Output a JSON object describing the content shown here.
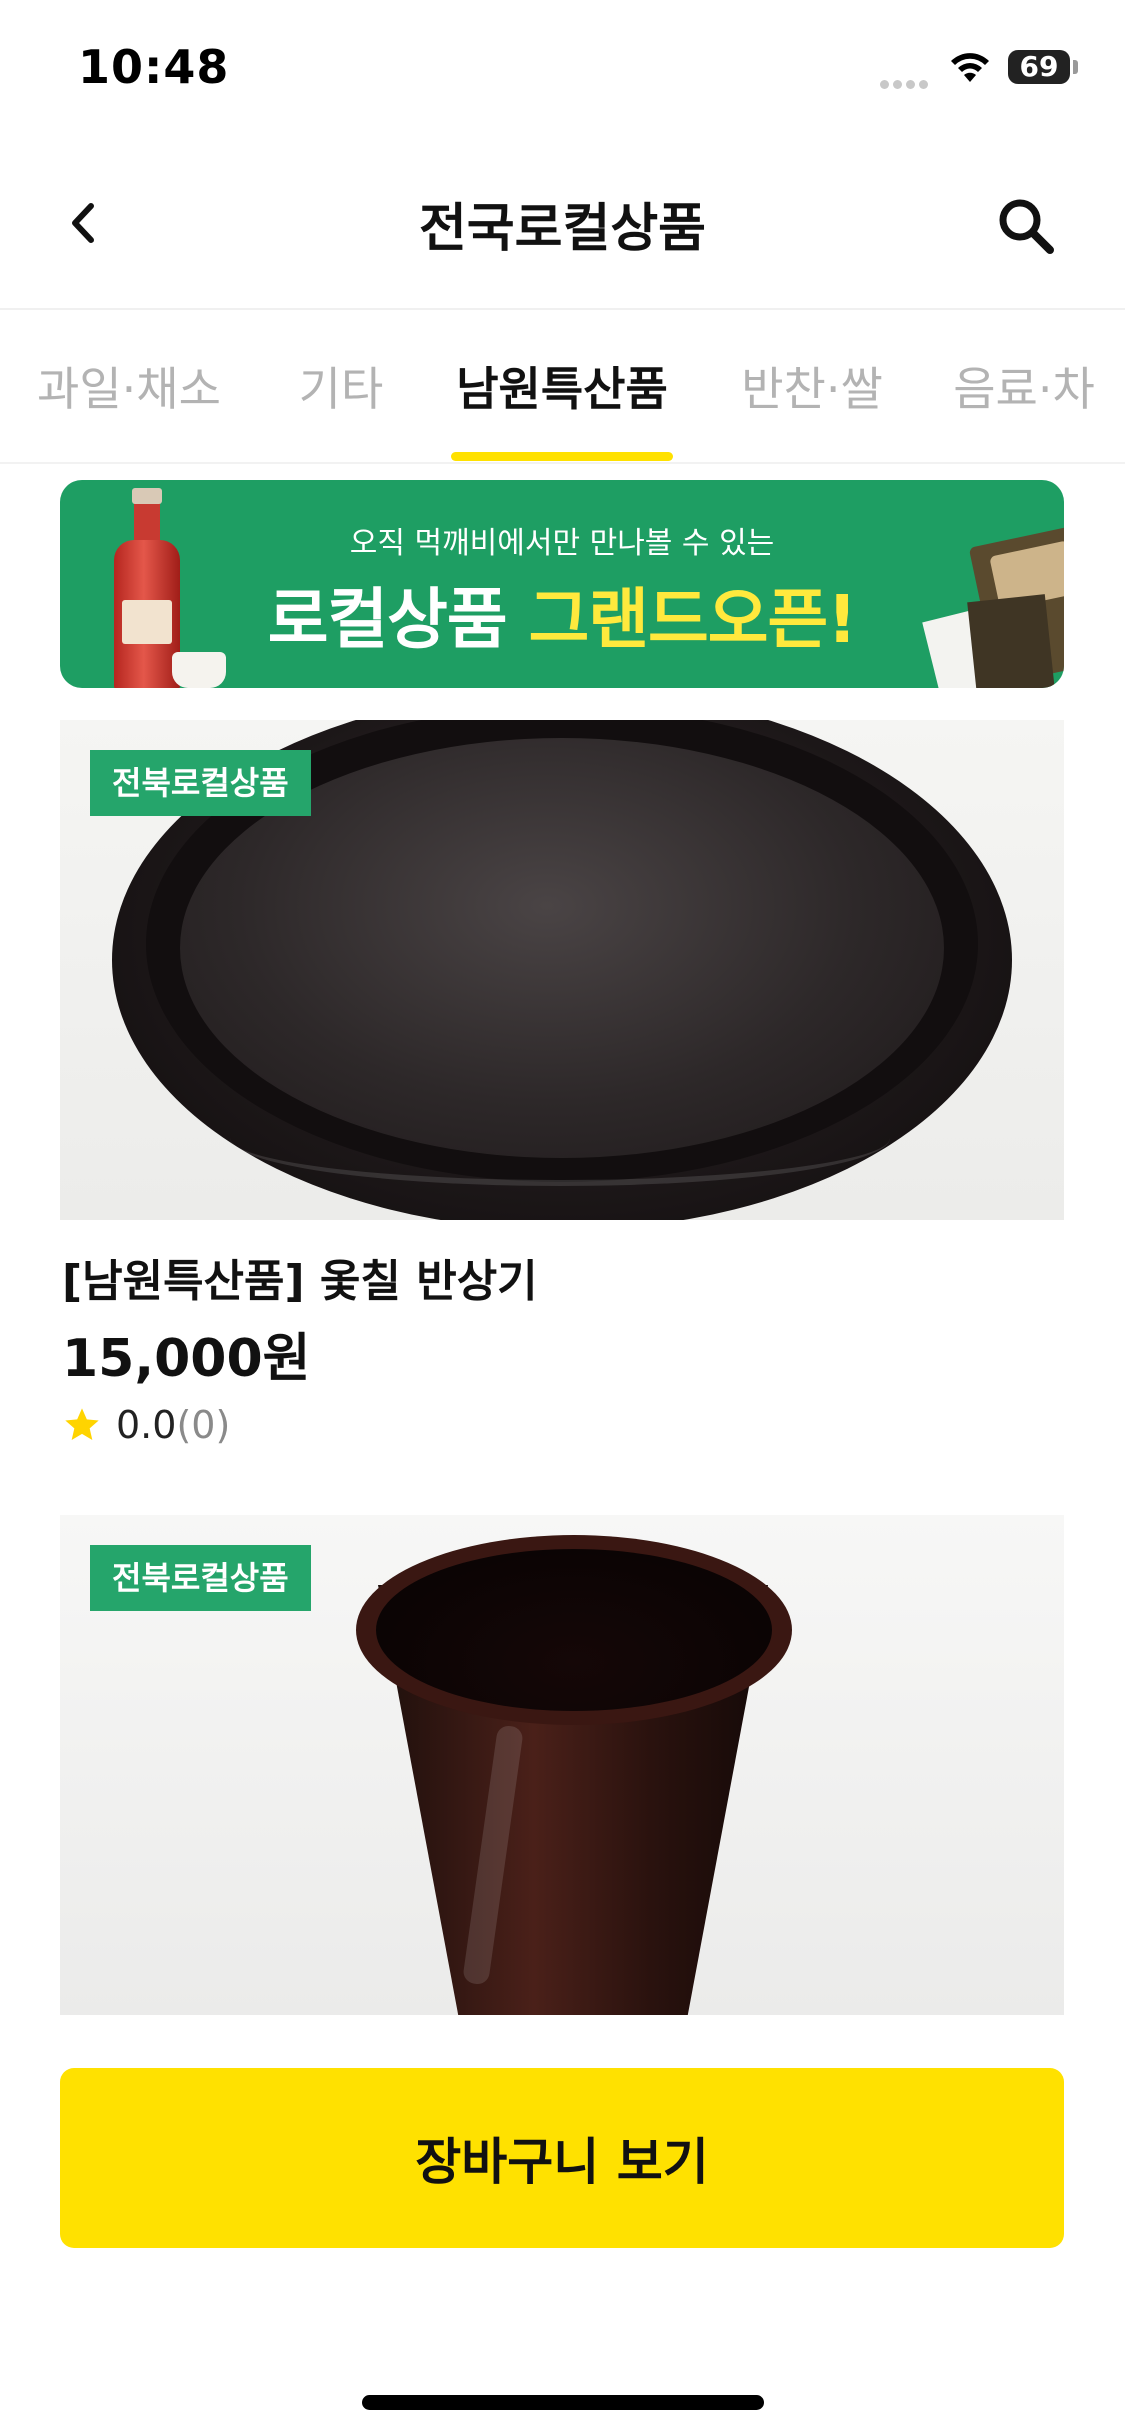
{
  "status_bar": {
    "time": "10:48",
    "battery": "69"
  },
  "header": {
    "title": "전국로컬상품"
  },
  "tabs": [
    {
      "label": "과일·채소",
      "active": false
    },
    {
      "label": "기타",
      "active": false
    },
    {
      "label": "남원특산품",
      "active": true
    },
    {
      "label": "반찬·쌀",
      "active": false
    },
    {
      "label": "음료·차",
      "active": false
    }
  ],
  "banner": {
    "subtitle": "오직 먹깨비에서만 만나볼 수 있는",
    "title_main": "로컬상품",
    "title_highlight": "그랜드오픈!"
  },
  "products": [
    {
      "badge": "전북로컬상품",
      "name": "[남원특산품] 옻칠 반상기",
      "price": "15,000원",
      "rating": "0.0",
      "review_count": "(0)"
    },
    {
      "badge": "전북로컬상품"
    }
  ],
  "cart_button": {
    "label": "장바구니 보기"
  },
  "colors": {
    "accent": "#FFE100",
    "badge": "#25a56b",
    "banner": "#1e9e63"
  }
}
